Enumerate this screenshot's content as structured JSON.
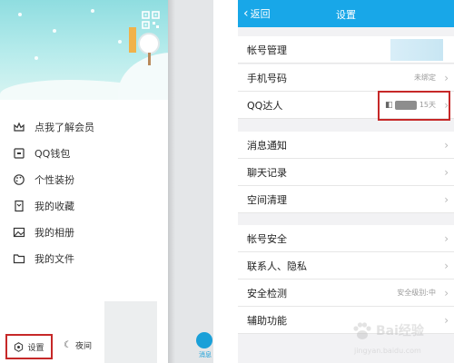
{
  "left_panel": {
    "menu": [
      {
        "label": "点我了解会员",
        "icon": "vip-crown-icon"
      },
      {
        "label": "QQ钱包",
        "icon": "wallet-icon"
      },
      {
        "label": "个性装扮",
        "icon": "palette-icon"
      },
      {
        "label": "我的收藏",
        "icon": "bookmark-icon"
      },
      {
        "label": "我的相册",
        "icon": "photo-icon"
      },
      {
        "label": "我的文件",
        "icon": "folder-icon"
      }
    ],
    "settings_label": "设置",
    "night_label": "夜间",
    "message_tab_label": "消息"
  },
  "right_panel": {
    "nav": {
      "back_label": "返回",
      "title": "设置"
    },
    "rows": {
      "account_manage": "帐号管理",
      "phone": {
        "label": "手机号码",
        "value": "未绑定"
      },
      "qq_daren": {
        "label": "QQ达人",
        "value": "15天"
      },
      "message_notify": "消息通知",
      "chat_history": "聊天记录",
      "space_clean": "空间清理",
      "account_security": "帐号安全",
      "contacts_privacy": "联系人、隐私",
      "security_check": {
        "label": "安全检测",
        "value": "安全级别:中"
      },
      "accessibility": "辅助功能"
    },
    "watermark": {
      "brand": "Bai经验",
      "sub": "jingyan.baidu.com"
    }
  },
  "colors": {
    "nav_blue": "#18a7e8",
    "highlight_red": "#c62828"
  }
}
